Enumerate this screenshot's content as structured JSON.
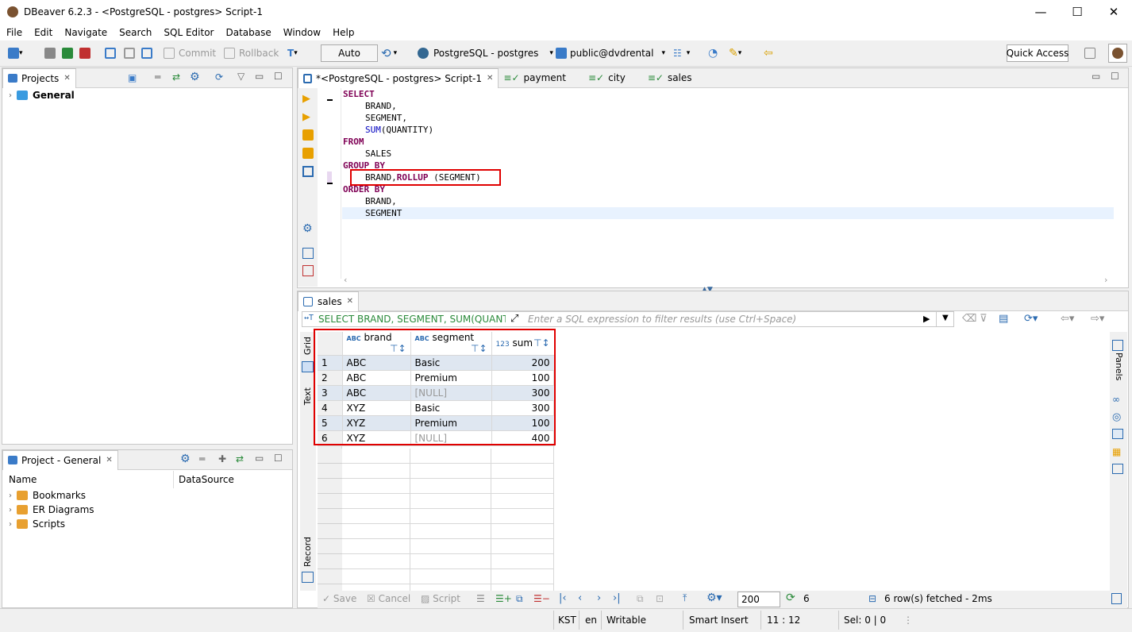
{
  "window": {
    "title": "DBeaver 6.2.3 - <PostgreSQL - postgres> Script-1",
    "minimize": "—",
    "maximize": "☐",
    "close": "✕"
  },
  "menu": [
    "File",
    "Edit",
    "Navigate",
    "Search",
    "SQL Editor",
    "Database",
    "Window",
    "Help"
  ],
  "toolbar": {
    "commit": "Commit",
    "rollback": "Rollback",
    "transaction_mode": "Auto",
    "connection": "PostgreSQL - postgres",
    "schema": "public@dvdrental",
    "quick_access": "Quick Access"
  },
  "projects_panel": {
    "tab": "Projects",
    "root": "General"
  },
  "project_general": {
    "tab": "Project - General",
    "col_name": "Name",
    "col_datasource": "DataSource",
    "items": [
      "Bookmarks",
      "ER Diagrams",
      "Scripts"
    ]
  },
  "editor": {
    "tabs": [
      {
        "label": "*<PostgreSQL - postgres> Script-1"
      },
      {
        "label": "payment"
      },
      {
        "label": "city"
      },
      {
        "label": "sales"
      }
    ],
    "sql": {
      "select": "SELECT",
      "brand": "BRAND,",
      "segment": "SEGMENT,",
      "sum_fn": "SUM",
      "sum_arg": "(QUANTITY)",
      "from": "FROM",
      "table": "SALES",
      "group_by": "GROUP BY",
      "group_brand": "BRAND,",
      "rollup": "ROLLUP",
      "rollup_arg": " (SEGMENT)",
      "order_by": "ORDER BY",
      "order_brand": "BRAND,",
      "order_segment": "SEGMENT"
    }
  },
  "results": {
    "tab": "sales",
    "query_label": "SELECT BRAND, SEGMENT, SUM(QUANTIT\\",
    "filter_placeholder": "Enter a SQL expression to filter results (use Ctrl+Space)",
    "columns": [
      {
        "type": "ABC",
        "name": "brand"
      },
      {
        "type": "ABC",
        "name": "segment"
      },
      {
        "type": "123",
        "name": "sum"
      }
    ],
    "rows": [
      [
        "1",
        "ABC",
        "Basic",
        "200"
      ],
      [
        "2",
        "ABC",
        "Premium",
        "100"
      ],
      [
        "3",
        "ABC",
        "[NULL]",
        "300"
      ],
      [
        "4",
        "XYZ",
        "Basic",
        "300"
      ],
      [
        "5",
        "XYZ",
        "Premium",
        "100"
      ],
      [
        "6",
        "XYZ",
        "[NULL]",
        "400"
      ]
    ],
    "side_tabs": {
      "grid": "Grid",
      "text": "Text",
      "record": "Record",
      "panels": "Panels"
    },
    "bottom": {
      "save": "Save",
      "cancel": "Cancel",
      "script": "Script",
      "fetch_size": "200",
      "row_count": "6",
      "fetched": "6 row(s) fetched - 2ms"
    }
  },
  "statusbar": {
    "tz": "KST",
    "lang": "en",
    "mode": "Writable",
    "insert": "Smart Insert",
    "pos": "11 : 12",
    "sel": "Sel: 0 | 0"
  }
}
